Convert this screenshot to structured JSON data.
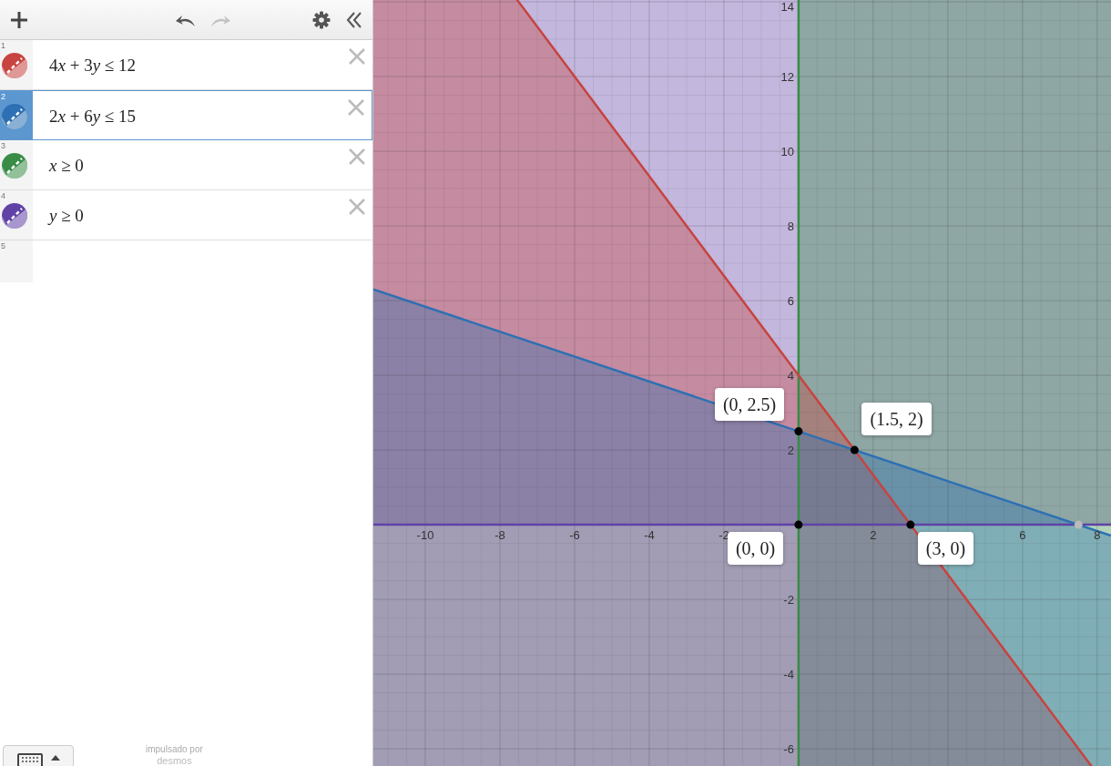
{
  "toolbar": {
    "redo_disabled": true
  },
  "expressions": [
    {
      "number": "1",
      "latex": "4x + 3y ≤ 12",
      "color": "#c74440",
      "selected": false
    },
    {
      "number": "2",
      "latex": "2x + 6y ≤ 15",
      "color": "#2d70b3",
      "selected": true
    },
    {
      "number": "3",
      "latex": "x ≥ 0",
      "color": "#388c46",
      "selected": false
    },
    {
      "number": "4",
      "latex": "y ≥ 0",
      "color": "#6042a6",
      "selected": false
    }
  ],
  "new_expression": {
    "number": "5"
  },
  "footer": {
    "powered_by": "impulsado por",
    "brand": "desmos"
  },
  "graph": {
    "x_tick_labels": [
      "-10",
      "-8",
      "-6",
      "-4",
      "-2",
      "2",
      "6",
      "8"
    ],
    "y_tick_labels": [
      "14",
      "12",
      "10",
      "8",
      "6",
      "4",
      "2",
      "-2",
      "-4",
      "-6"
    ],
    "point_labels": [
      "(0, 2.5)",
      "(1.5, 2)",
      "(0, 0)",
      "(3, 0)"
    ]
  }
}
